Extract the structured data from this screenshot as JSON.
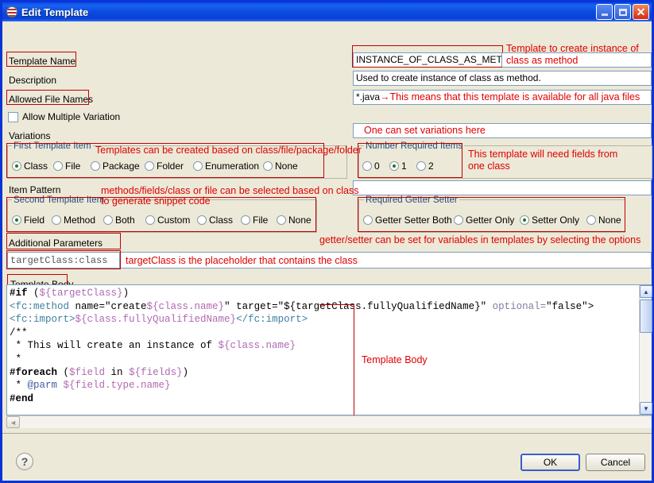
{
  "window": {
    "title": "Edit Template",
    "buttons": {
      "minimize": "minimize",
      "maximize": "maximize",
      "close": "close"
    }
  },
  "form": {
    "template_name_label": "Template Name",
    "template_name_value": "INSTANCE_OF_CLASS_AS_METHOD",
    "description_label": "Description",
    "description_value": "Used to create instance of class as method.",
    "allowed_file_names_label": "Allowed File Names",
    "allowed_file_names_value": "*.java",
    "allow_multiple_variation_label": "Allow Multiple Variation",
    "allow_multiple_variation_checked": false,
    "variations_label": "Variations",
    "variations_value": "",
    "item_pattern_label": "Item Pattern",
    "item_pattern_value": "",
    "additional_parameters_label": "Additional Parameters",
    "additional_parameters_value": "targetClass:class",
    "template_body_label": "Template Body"
  },
  "groups": {
    "first_template_item": {
      "title": "First Template Item",
      "options": [
        "Class",
        "File",
        "Package",
        "Folder",
        "Enumeration",
        "None"
      ],
      "selected": "Class"
    },
    "number_required_items": {
      "title": "Number Required Items",
      "options": [
        "0",
        "1",
        "2"
      ],
      "selected": "1"
    },
    "second_template_item": {
      "title": "Second Template Item",
      "options": [
        "Field",
        "Method",
        "Both",
        "Custom",
        "Class",
        "File",
        "None"
      ],
      "selected": "Field"
    },
    "required_getter_setter": {
      "title": "Required Getter Setter",
      "options": [
        "Getter Setter Both",
        "Getter Only",
        "Setter Only",
        "None"
      ],
      "selected": "Setter Only"
    }
  },
  "annotations": {
    "template_name": "Template to create instance of\nclass as method",
    "template_name_line1": "Template to create instance of",
    "template_name_line2": "class as method",
    "allowed_file_names": "→This means that this template is available for all java files",
    "variations": "One can set variations here",
    "first_template_item": "Templates can be created based on class/file/package/folder",
    "number_required_items_line1": "This template will need fields from",
    "number_required_items_line2": "one class",
    "item_pattern_line1": "methods/fields/class or file can be selected based on class",
    "item_pattern_line2": "to generate snippet code",
    "getter_setter": "getter/setter can be set for variables in templates by selecting the options",
    "additional_parameters": "targetClass is the placeholder that contains the class",
    "template_body": "Template Body"
  },
  "code": {
    "lines": [
      [
        {
          "t": "#if ",
          "c": "k"
        },
        {
          "t": "(",
          "c": "plain"
        },
        {
          "t": "${targetClass}",
          "c": "var"
        },
        {
          "t": ")",
          "c": "plain"
        }
      ],
      [
        {
          "t": "<fc:method ",
          "c": "tag"
        },
        {
          "t": "name=",
          "c": "plain"
        },
        {
          "t": "\"create",
          "c": "plain"
        },
        {
          "t": "${class.name}",
          "c": "var"
        },
        {
          "t": "\" ",
          "c": "plain"
        },
        {
          "t": "target=",
          "c": "plain"
        },
        {
          "t": "\"${targetClass.fullyQualifiedName}\" ",
          "c": "plain"
        },
        {
          "t": "optional=",
          "c": "attr"
        },
        {
          "t": "\"false\"",
          "c": "plain"
        },
        {
          "t": ">",
          "c": "plain"
        }
      ],
      [
        {
          "t": "<fc:import>",
          "c": "tag"
        },
        {
          "t": "${class.fullyQualifiedName}",
          "c": "var"
        },
        {
          "t": "</fc:import>",
          "c": "tag"
        }
      ],
      [
        {
          "t": "/**",
          "c": "plain"
        }
      ],
      [
        {
          "t": " * This will create an instance of ",
          "c": "plain"
        },
        {
          "t": "${class.name}",
          "c": "var"
        }
      ],
      [
        {
          "t": " *",
          "c": "plain"
        }
      ],
      [
        {
          "t": "#foreach ",
          "c": "k"
        },
        {
          "t": "(",
          "c": "plain"
        },
        {
          "t": "$field",
          "c": "var"
        },
        {
          "t": " in ",
          "c": "plain"
        },
        {
          "t": "${fields}",
          "c": "var"
        },
        {
          "t": ")",
          "c": "plain"
        }
      ],
      [
        {
          "t": " * ",
          "c": "plain"
        },
        {
          "t": "@parm ",
          "c": "cmt"
        },
        {
          "t": "${field.type.name}",
          "c": "var"
        }
      ],
      [
        {
          "t": "#end",
          "c": "k"
        }
      ]
    ]
  },
  "footer": {
    "help_label": "?",
    "ok_label": "OK",
    "cancel_label": "Cancel"
  },
  "colors": {
    "titlebar": "#0B4BE0",
    "window_border": "#0A34D6",
    "dialog_background": "#ece9d8",
    "annotation_red": "#e10000",
    "redbox_border": "#c00000",
    "field_border": "#7F9DB9",
    "group_title": "#2a4a7a"
  },
  "scrollbars": {
    "vertical_up": "▲",
    "vertical_down": "▼",
    "horizontal_left": "◄"
  }
}
